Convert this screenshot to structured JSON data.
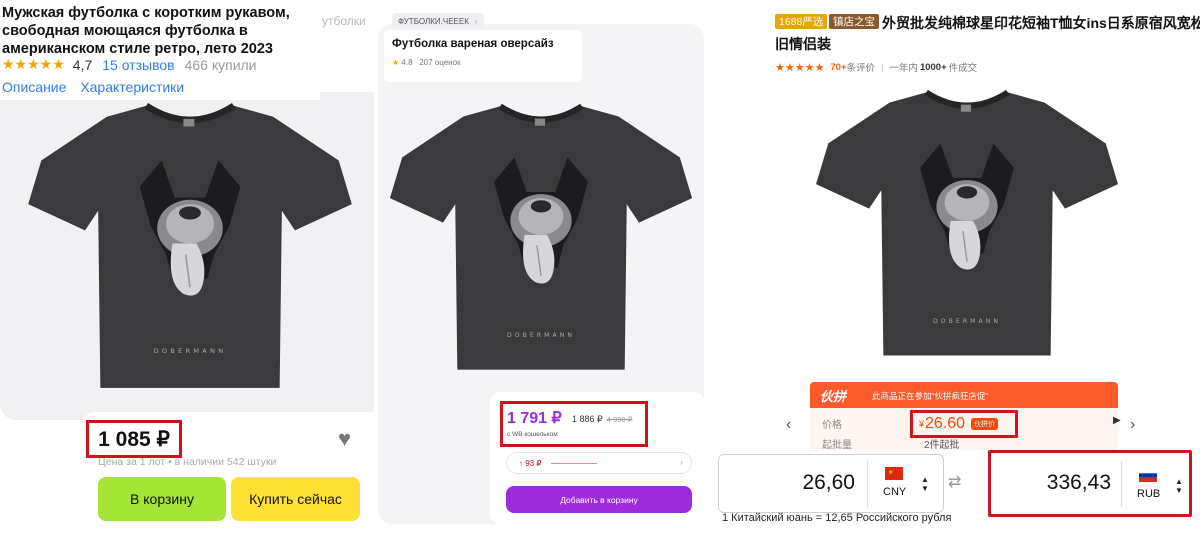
{
  "panel1": {
    "title": "Мужская футболка с коротким рукавом, свободная моющаяся футболка в американском стиле ретро, лето 2023",
    "ghost_tab": "утболки",
    "stars": "★★★★★",
    "rating": "4,7",
    "reviews": "15 отзывов",
    "bought": "466 купили",
    "tabs": [
      "Описание",
      "Характеристики"
    ],
    "price": "1 085 ₽",
    "price_note": "Цена за 1 лот • в наличии 542 штуки",
    "heart_icon": "heart-icon",
    "buttons": {
      "cart": "В корзину",
      "buy": "Купить сейчас"
    },
    "colors": {
      "cart": "#a3e635",
      "buy": "#ffe135",
      "link": "#2f7df6"
    }
  },
  "panel2": {
    "breadcrumb": "ФУТБОЛКИ.ЧЕЕЕК",
    "title": "Футболка вареная оверсайз",
    "star": "★",
    "rating": "4.8",
    "reviews": "207 оценок",
    "price": "1 791 ₽",
    "price_plain": "1 886 ₽",
    "price_old": "4 990 ₽",
    "wallet_note": "с WB кошельком",
    "history_value": "↑ 93 ₽",
    "add_button": "Добавить в корзину",
    "colors": {
      "accent": "#9b2bdb"
    }
  },
  "panel3": {
    "badge_1688": "1688严选",
    "badge_store": "镇店之宝",
    "title_line1": "外贸批发纯棉球星印花短袖T恤女ins日系原宿风宽松水",
    "title_line2": "旧情侣装",
    "stars": "★★★★★",
    "rating_count": "70+",
    "rating_label": "条评价",
    "period_label": "一年内",
    "sold_count": "1000+",
    "sold_label": "件成交",
    "promo_logo": "伙拼",
    "promo_text": "此商品正在参加“伙拼疯狂店促”",
    "price_label": "价格",
    "min_label": "起批量",
    "currency_sign": "¥",
    "price": "26.60",
    "price_tag": "伙拼价",
    "min_qty": "2件起批",
    "converter": {
      "from_value": "26,60",
      "from_code": "CNY",
      "to_value": "336,43",
      "to_code": "RUB",
      "rate_note": "1 Китайский юань = 12,65 Российского рубля"
    },
    "colors": {
      "orange": "#ff4400",
      "promo": "#ff5a2b",
      "highlight_box": "#d5101a"
    }
  },
  "product_print_text": "DOBERMANN"
}
